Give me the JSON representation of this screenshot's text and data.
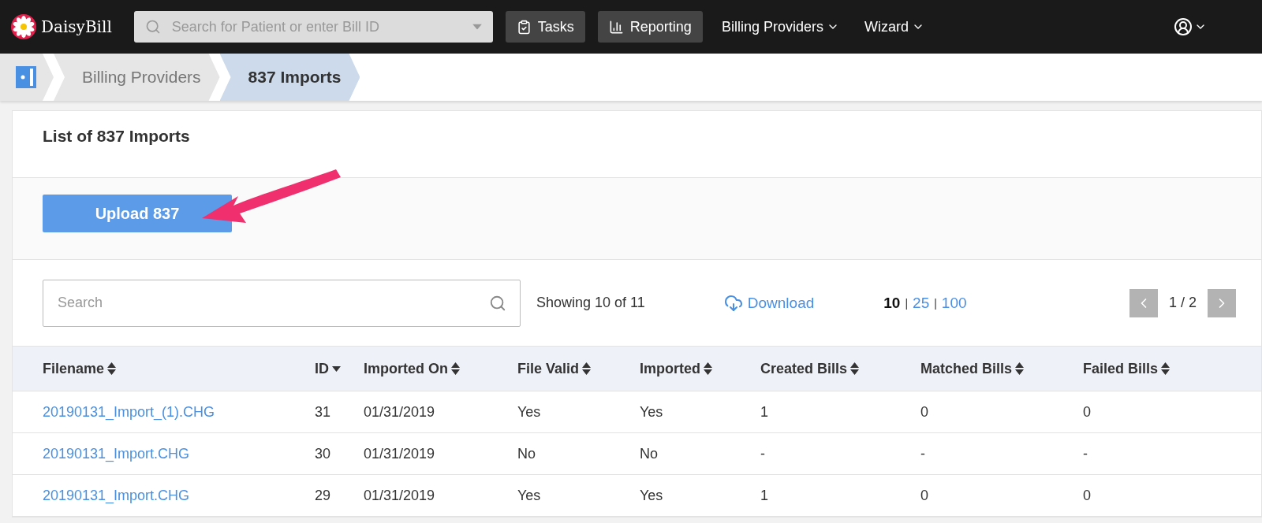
{
  "navbar": {
    "brand": "DaisyBill",
    "search": {
      "placeholder": "Search for Patient or enter Bill ID"
    },
    "buttons": [
      {
        "label": "Tasks",
        "kind": "tasks"
      },
      {
        "label": "Reporting",
        "kind": "reporting"
      }
    ],
    "menus": [
      "Billing Providers",
      "Wizard"
    ]
  },
  "breadcrumb": [
    {
      "label": "Billing Providers",
      "selected": false
    },
    {
      "label": "837 Imports",
      "selected": true
    }
  ],
  "card": {
    "title": "List of 837 Imports",
    "upload_button": "Upload 837"
  },
  "toolbar": {
    "search": {
      "placeholder": "Search"
    },
    "showing": "Showing 10 of 11",
    "download": "Download",
    "page_sizes": [
      {
        "label": "10",
        "selected": true
      },
      {
        "label": "25",
        "selected": false,
        "separator": "|"
      },
      {
        "label": "100",
        "selected": false,
        "separator": "|"
      }
    ],
    "page": "1 / 2"
  },
  "table": {
    "columns": [
      {
        "label": "Filename",
        "sorted": false
      },
      {
        "label": "ID",
        "sorted": true
      },
      {
        "label": "Imported On",
        "sorted": false
      },
      {
        "label": "File Valid",
        "sorted": false
      },
      {
        "label": "Imported",
        "sorted": false
      },
      {
        "label": "Created Bills",
        "sorted": false
      },
      {
        "label": "Matched Bills",
        "sorted": false
      },
      {
        "label": "Failed Bills",
        "sorted": false
      }
    ],
    "rows": [
      [
        "20190131_Import_(1).CHG",
        "31",
        "01/31/2019",
        "Yes",
        "Yes",
        "1",
        "0",
        "0"
      ],
      [
        "20190131_Import.CHG",
        "30",
        "01/31/2019",
        "No",
        "No",
        "-",
        "-",
        "-"
      ],
      [
        "20190131_Import.CHG",
        "29",
        "01/31/2019",
        "Yes",
        "Yes",
        "1",
        "0",
        "0"
      ]
    ]
  }
}
